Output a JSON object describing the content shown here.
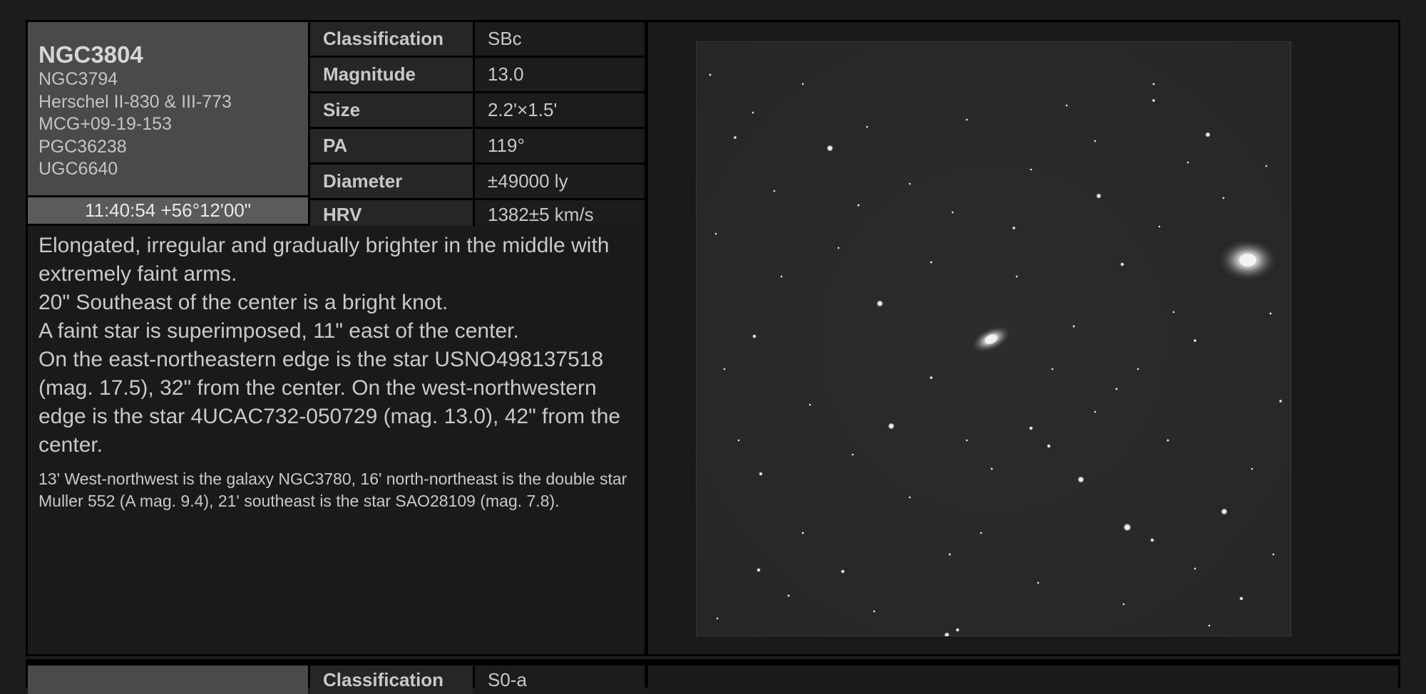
{
  "object": {
    "name": "NGC3804",
    "aliases": [
      "NGC3794",
      "Herschel II-830 & III-773",
      "MCG+09-19-153",
      "PGC36238",
      "UGC6640"
    ],
    "coordinates": "11:40:54 +56°12'00\""
  },
  "properties": [
    {
      "label": "Classification",
      "value": "SBc"
    },
    {
      "label": "Magnitude",
      "value": "13.0"
    },
    {
      "label": "Size",
      "value": "2.2'×1.5'"
    },
    {
      "label": "PA",
      "value": "119°"
    },
    {
      "label": "Diameter",
      "value": "±49000 ly"
    },
    {
      "label": "HRV",
      "value": "1382±5 km/s"
    }
  ],
  "description": {
    "main": "Elongated, irregular and gradually brighter in the middle with extremely faint arms.\n20\" Southeast of the center is a bright knot.\nA faint star is superimposed, 11\" east of the center.\nOn the east-northeastern edge is the star USNO498137518 (mag. 17.5), 32\" from the center. On the west-northwestern edge is the star 4UCAC732-050729 (mag. 13.0), 42\" from the center.",
    "note": "13' West-northwest is the galaxy NGC3780, 16' north-northeast is the double star Muller 552 (A mag. 9.4), 21' southeast is the star SAO28109 (mag. 7.8)."
  },
  "next_card": {
    "classification_label": "Classification",
    "classification_value": "S0-a"
  }
}
